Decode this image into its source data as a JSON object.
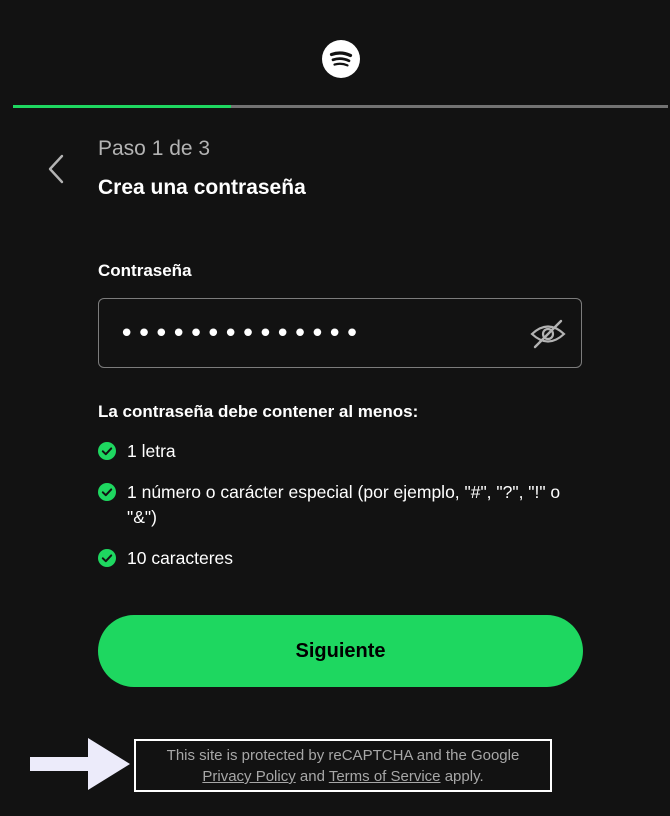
{
  "header": {
    "logo_icon": "spotify-logo-icon",
    "progress_fraction": 0.333
  },
  "step": {
    "back_icon": "chevron-left-icon",
    "label": "Paso 1 de 3",
    "title": "Crea una contraseña"
  },
  "password": {
    "label": "Contraseña",
    "value": "••••••••••••••",
    "toggle_icon": "eye-slash-icon"
  },
  "requirements": {
    "heading": "La contraseña debe contener al menos:",
    "items": [
      {
        "text": "1 letra",
        "icon": "check-circle-icon"
      },
      {
        "text": "1 número o carácter especial (por ejemplo, \"#\", \"?\", \"!\" o \"&\")",
        "icon": "check-circle-icon"
      },
      {
        "text": "10 caracteres",
        "icon": "check-circle-icon"
      }
    ]
  },
  "next_button": {
    "label": "Siguiente"
  },
  "recaptcha": {
    "line1": "This site is protected by reCAPTCHA and the Google",
    "privacy_link": "Privacy Policy",
    "and_text": "and",
    "terms_link": "Terms of Service",
    "apply_text": "apply."
  },
  "annotation": {
    "arrow_icon": "arrow-right-icon"
  },
  "colors": {
    "background": "#121212",
    "accent": "#1ed760",
    "progress_track": "#727272",
    "muted_text": "#b3b3b3"
  }
}
